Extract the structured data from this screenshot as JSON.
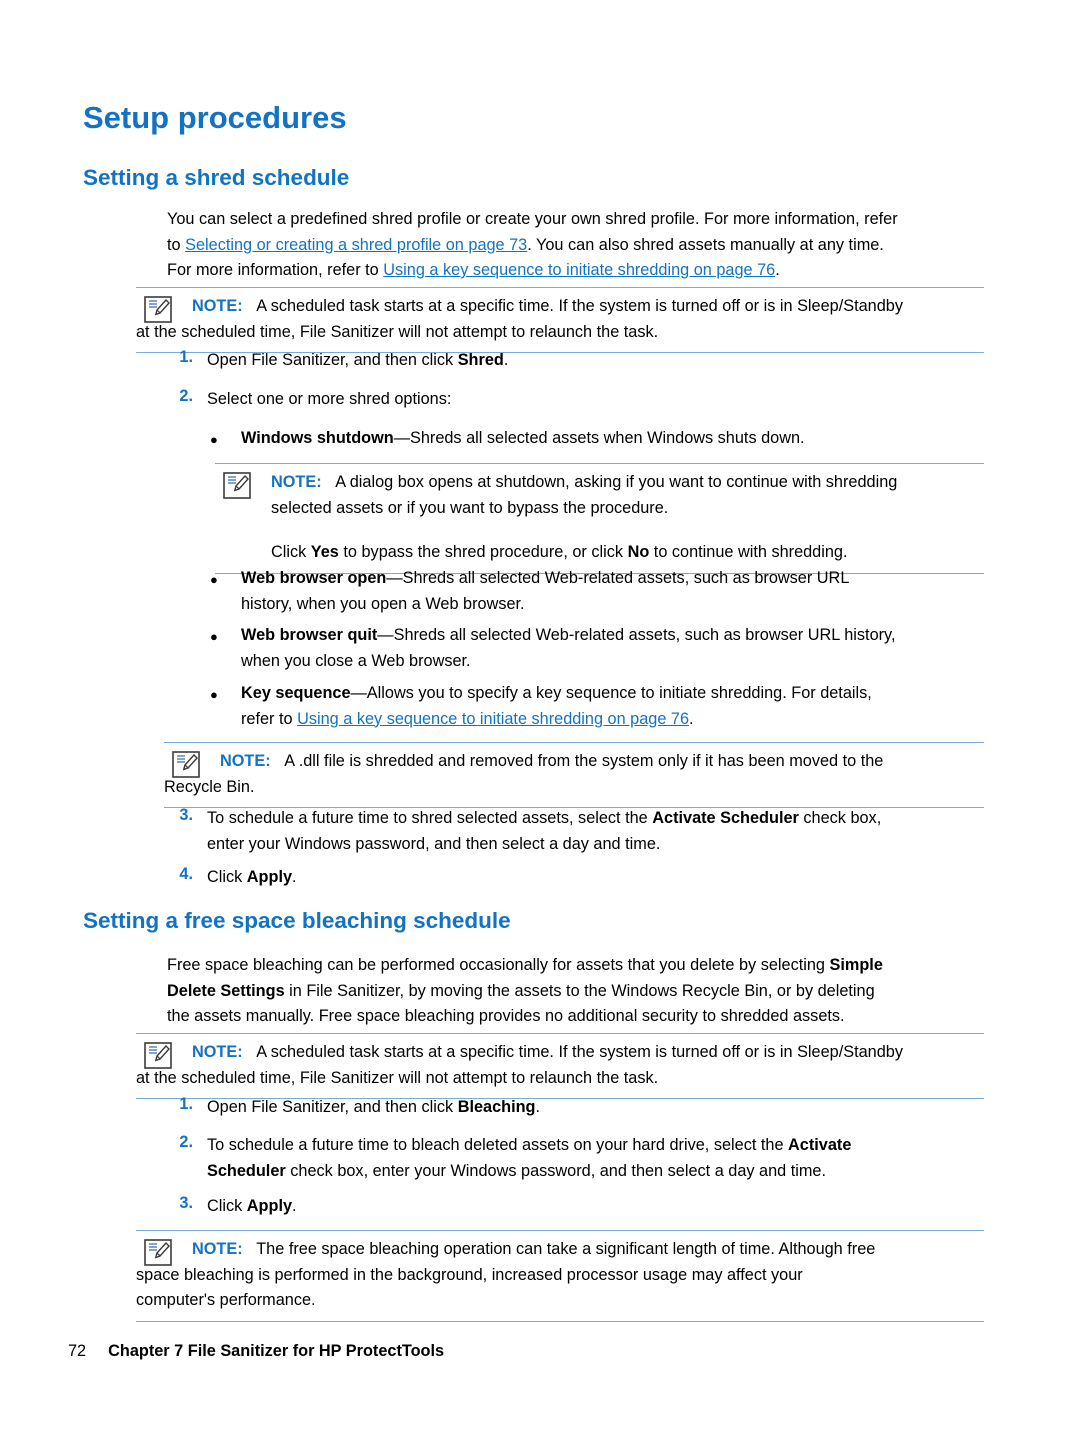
{
  "page": {
    "title": "Setup procedures",
    "footer": {
      "page_number": "72",
      "chapter": "Chapter 7   File Sanitizer for HP ProtectTools"
    }
  },
  "section1": {
    "heading": "Setting a shred schedule",
    "intro_1": "You can select a predefined shred profile or create your own shred profile. For more information, refer",
    "intro_2_pre": "to ",
    "intro_2_link": "Selecting or creating a shred profile on page 73",
    "intro_2_post": ". You can also shred assets manually at any time.",
    "intro_3_pre": "For more information, refer to ",
    "intro_3_link": "Using a key sequence to initiate shredding on page 76",
    "intro_3_post": ".",
    "note1": {
      "label": "NOTE:",
      "text_1": "A scheduled task starts at a specific time. If the system is turned off or is in Sleep/Standby",
      "text_2": "at the scheduled time, File Sanitizer will not attempt to relaunch the task."
    },
    "steps": [
      {
        "num": "1.",
        "text_pre": "Open File Sanitizer, and then click ",
        "bold": "Shred",
        "text_post": "."
      },
      {
        "num": "2.",
        "text_pre": "Select one or more shred options:",
        "bold": "",
        "text_post": ""
      }
    ],
    "bullets": [
      {
        "bold": "Windows shutdown",
        "text": "—Shreds all selected assets when Windows shuts down."
      },
      {
        "bold": "Web browser open",
        "text": "—Shreds all selected Web-related assets, such as browser URL",
        "text2": "history, when you open a Web browser."
      },
      {
        "bold": "Web browser quit",
        "text": "—Shreds all selected Web-related assets, such as browser URL history,",
        "text2": "when you close a Web browser."
      },
      {
        "bold": "Key sequence",
        "text": "—Allows you to specify a key sequence to initiate shredding. For details,",
        "text2_pre": "refer to ",
        "text2_link": "Using a key sequence to initiate shredding on page 76",
        "text2_post": "."
      }
    ],
    "note2": {
      "label": "NOTE:",
      "text_1": "A dialog box opens at shutdown, asking if you want to continue with shredding",
      "text_2": "selected assets or if you want to bypass the procedure.",
      "text_3_pre": "Click ",
      "text_3_b1": "Yes",
      "text_3_mid": " to bypass the shred procedure, or click ",
      "text_3_b2": "No",
      "text_3_post": " to continue with shredding."
    },
    "note3": {
      "label": "NOTE:",
      "text_1": "A .dll file is shredded and removed from the system only if it has been moved to the",
      "text_2": "Recycle Bin."
    },
    "step3": {
      "num": "3.",
      "text_pre": "To schedule a future time to shred selected assets, select the ",
      "bold": "Activate Scheduler",
      "text_post": " check box,",
      "line2": "enter your Windows password, and then select a day and time."
    },
    "step4": {
      "num": "4.",
      "text_pre": "Click ",
      "bold": "Apply",
      "text_post": "."
    }
  },
  "section2": {
    "heading": "Setting a free space bleaching schedule",
    "intro_1_pre": "Free space bleaching can be performed occasionally for assets that you delete by selecting ",
    "intro_1_bold": "Simple",
    "intro_2_bold": "Delete Settings",
    "intro_2_post": " in File Sanitizer, by moving the assets to the Windows Recycle Bin, or by deleting",
    "intro_3": "the assets manually. Free space bleaching provides no additional security to shredded assets.",
    "note1": {
      "label": "NOTE:",
      "text_1": "A scheduled task starts at a specific time. If the system is turned off or is in Sleep/Standby",
      "text_2": "at the scheduled time, File Sanitizer will not attempt to relaunch the task."
    },
    "steps": [
      {
        "num": "1.",
        "text_pre": "Open File Sanitizer, and then click ",
        "bold": "Bleaching",
        "text_post": "."
      }
    ],
    "step2": {
      "num": "2.",
      "text_pre": "To schedule a future time to bleach deleted assets on your hard drive, select the ",
      "bold": "Activate",
      "line2_bold": "Scheduler",
      "line2_post": " check box, enter your Windows password, and then select a day and time."
    },
    "step3": {
      "num": "3.",
      "text_pre": "Click ",
      "bold": "Apply",
      "text_post": "."
    },
    "note2": {
      "label": "NOTE:",
      "text_1": "The free space bleaching operation can take a significant length of time. Although free",
      "text_2": "space bleaching is performed in the background, increased processor usage may affect your",
      "text_3": "computer's performance."
    }
  },
  "colors": {
    "accent": "#1273c4",
    "note_rule": "#7aa9dd"
  }
}
